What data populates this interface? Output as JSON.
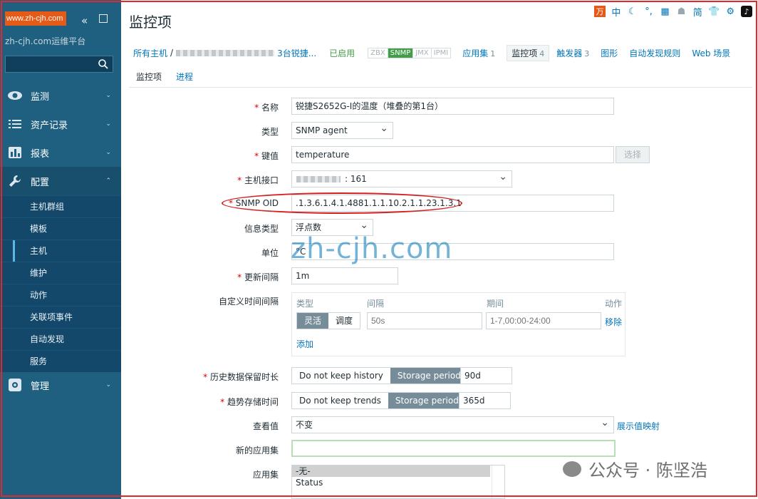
{
  "sidebar": {
    "logo_text": "www.zh-cjh.com",
    "site_name": "zh-cjh.com运维平台",
    "search_placeholder": "",
    "menu": [
      {
        "label": "监测"
      },
      {
        "label": "资产记录"
      },
      {
        "label": "报表"
      },
      {
        "label": "配置"
      },
      {
        "label": "管理"
      }
    ],
    "config_items": [
      "主机群组",
      "模板",
      "主机",
      "维护",
      "动作",
      "关联项事件",
      "自动发现",
      "服务"
    ]
  },
  "header": {
    "title": "监控项"
  },
  "nav": {
    "all_hosts": "所有主机",
    "sep": "/",
    "host_suffix": "3台锐捷...",
    "enabled": "已启用",
    "availability": [
      "ZBX",
      "SNMP",
      "JMX",
      "IPMI"
    ],
    "tabs": [
      {
        "label": "应用集",
        "count": "1"
      },
      {
        "label": "监控项",
        "count": "4"
      },
      {
        "label": "触发器",
        "count": "3"
      },
      {
        "label": "图形",
        "count": ""
      },
      {
        "label": "自动发现规则",
        "count": ""
      },
      {
        "label": "Web 场景",
        "count": ""
      }
    ]
  },
  "subtabs": [
    "监控项",
    "进程"
  ],
  "form": {
    "name_label": "名称",
    "name_value": "锐捷S2652G-I的温度（堆叠的第1台）",
    "type_label": "类型",
    "type_value": "SNMP agent",
    "key_label": "键值",
    "key_value": "temperature",
    "select_button": "选择",
    "iface_label": "主机接口",
    "iface_value": ": 161",
    "oid_label": "SNMP OID",
    "oid_value": ".1.3.6.1.4.1.4881.1.1.10.2.1.1.23.1.3.1",
    "info_type_label": "信息类型",
    "info_type_value": "浮点数",
    "units_label": "单位",
    "units_value": "°C",
    "update_label": "更新间隔",
    "update_value": "1m",
    "custom_label": "自定义时间间隔",
    "custom_headers": [
      "类型",
      "间隔",
      "期间",
      "动作"
    ],
    "custom_modes": [
      "灵活",
      "调度"
    ],
    "custom_interval_placeholder": "50s",
    "custom_period_placeholder": "1-7,00:00-24:00",
    "custom_remove": "移除",
    "custom_add": "添加",
    "history_label": "历史数据保留时长",
    "history_options": [
      "Do not keep history",
      "Storage period"
    ],
    "history_value": "90d",
    "trends_label": "趋势存储时间",
    "trends_options": [
      "Do not keep trends",
      "Storage period"
    ],
    "trends_value": "365d",
    "valuemap_label": "查看值",
    "valuemap_value": "不变",
    "valuemap_link": "展示值映射",
    "newapp_label": "新的应用集",
    "newapp_value": "",
    "apps_label": "应用集",
    "apps_options": [
      "-无-",
      "Status"
    ]
  },
  "overlays": {
    "watermark": "zh-cjh.com",
    "wechat": "公众号 · 陈坚浩"
  },
  "top_tools": [
    "万",
    "中",
    "☾",
    "°,",
    "▦",
    "☗",
    "简",
    "👕",
    "⚙",
    "♪"
  ]
}
